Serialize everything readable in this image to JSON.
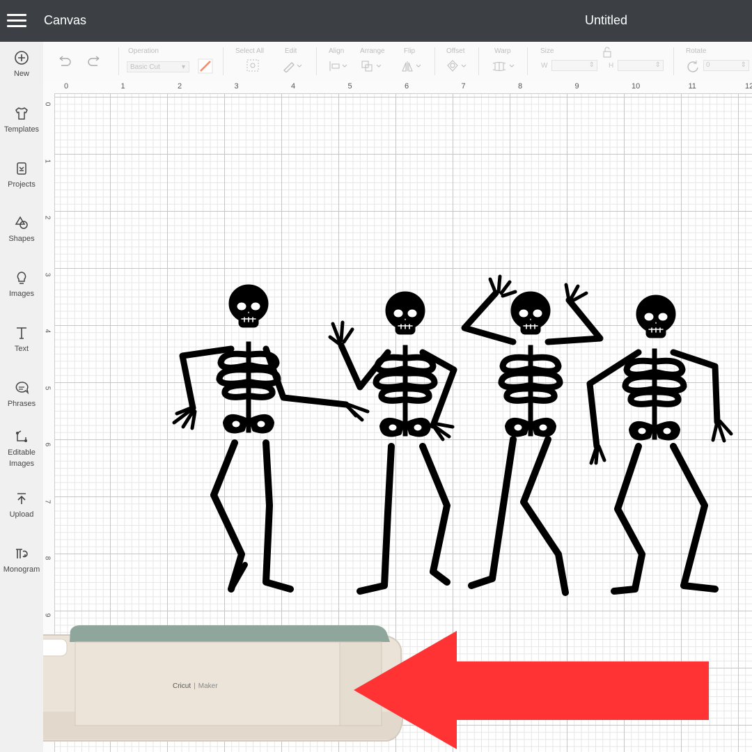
{
  "app": {
    "title": "Canvas",
    "document_title": "Untitled"
  },
  "sidebar": {
    "items": [
      {
        "label": "New",
        "icon": "plus-circle-icon"
      },
      {
        "label": "Templates",
        "icon": "shirt-icon"
      },
      {
        "label": "Projects",
        "icon": "projects-icon"
      },
      {
        "label": "Shapes",
        "icon": "shapes-icon"
      },
      {
        "label": "Images",
        "icon": "lightbulb-icon"
      },
      {
        "label": "Text",
        "icon": "text-icon"
      },
      {
        "label": "Phrases",
        "icon": "speech-bubble-icon"
      },
      {
        "label": "Editable\nImages",
        "icon": "editable-images-icon"
      },
      {
        "label": "Upload",
        "icon": "upload-icon"
      },
      {
        "label": "Monogram",
        "icon": "monogram-icon"
      }
    ]
  },
  "toolbar": {
    "operation_label": "Operation",
    "operation_value": "Basic Cut",
    "select_all_label": "Select All",
    "edit_label": "Edit",
    "align_label": "Align",
    "arrange_label": "Arrange",
    "flip_label": "Flip",
    "offset_label": "Offset",
    "warp_label": "Warp",
    "size_label": "Size",
    "size_w_label": "W",
    "size_h_label": "H",
    "rotate_label": "Rotate",
    "rotate_value": "0"
  },
  "ruler": {
    "top": [
      "0",
      "1",
      "2",
      "3",
      "4",
      "5",
      "6",
      "7",
      "8",
      "9",
      "10",
      "11",
      "12"
    ],
    "left": [
      "0",
      "1",
      "2",
      "3",
      "4",
      "5",
      "6",
      "7",
      "8",
      "9"
    ]
  },
  "machine": {
    "brand": "Cricut",
    "model": "Maker"
  },
  "colors": {
    "topbar": "#3c4045",
    "arrow": "#ff3333",
    "machine_lid": "#8ea69c",
    "machine_body": "#e9e1d6"
  }
}
